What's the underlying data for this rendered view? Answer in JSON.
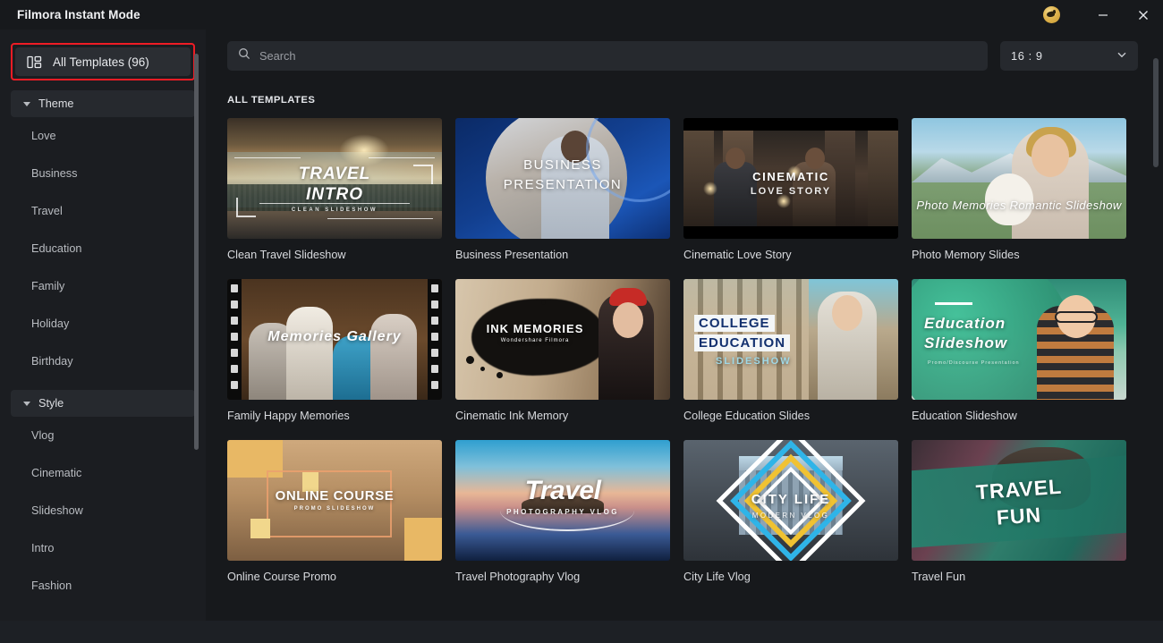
{
  "window": {
    "title": "Filmora Instant Mode",
    "brand_icon": "bird-badge-icon",
    "minimize_label": "Minimize",
    "close_label": "Close"
  },
  "sidebar": {
    "all_templates": {
      "icon": "layout-grid-icon",
      "label": "All Templates (96)",
      "count": 96,
      "highlight_color": "#ee1c25",
      "selected": true
    },
    "groups": [
      {
        "label": "Theme",
        "expanded": true,
        "items": [
          {
            "label": "Love"
          },
          {
            "label": "Business"
          },
          {
            "label": "Travel"
          },
          {
            "label": "Education"
          },
          {
            "label": "Family"
          },
          {
            "label": "Holiday"
          },
          {
            "label": "Birthday"
          }
        ]
      },
      {
        "label": "Style",
        "expanded": true,
        "items": [
          {
            "label": "Vlog"
          },
          {
            "label": "Cinematic"
          },
          {
            "label": "Slideshow"
          },
          {
            "label": "Intro"
          },
          {
            "label": "Fashion"
          }
        ]
      }
    ]
  },
  "toolbar": {
    "search": {
      "icon": "search-icon",
      "placeholder": "Search",
      "value": ""
    },
    "aspect_ratio": {
      "value": "16 : 9",
      "icon": "chevron-down-icon"
    }
  },
  "main": {
    "section_title": "ALL TEMPLATES",
    "templates": [
      {
        "name": "Clean Travel Slideshow",
        "thumb_text": [
          "TRAVEL",
          "INTRO",
          "CLEAN SLIDESHOW"
        ]
      },
      {
        "name": "Business Presentation",
        "thumb_text": [
          "BUSINESS",
          "PRESENTATION"
        ]
      },
      {
        "name": "Cinematic Love Story",
        "thumb_text": [
          "CINEMATIC",
          "LOVE STORY"
        ]
      },
      {
        "name": "Photo Memory Slides",
        "thumb_text": [
          "Photo Memories Romantic Slideshow"
        ]
      },
      {
        "name": "Family Happy Memories",
        "thumb_text": [
          "Memories Gallery"
        ]
      },
      {
        "name": "Cinematic Ink Memory",
        "thumb_text": [
          "INK MEMORIES",
          "Wondershare Filmora"
        ]
      },
      {
        "name": "College Education Slides",
        "thumb_text": [
          "COLLEGE",
          "EDUCATION",
          "SLIDESHOW"
        ]
      },
      {
        "name": "Education Slideshow",
        "thumb_text": [
          "Education",
          "Slideshow",
          "Promo/Discourse Presentation"
        ]
      },
      {
        "name": "Online Course Promo",
        "thumb_text": [
          "ONLINE COURSE",
          "PROMO SLIDESHOW"
        ]
      },
      {
        "name": "Travel Photography Vlog",
        "thumb_text": [
          "Travel",
          "PHOTOGRAPHY VLOG"
        ]
      },
      {
        "name": "City Life Vlog",
        "thumb_text": [
          "CITY LIFE",
          "MODERN VLOG"
        ]
      },
      {
        "name": "Travel Fun",
        "thumb_text": [
          "TRAVEL",
          "FUN"
        ]
      }
    ]
  },
  "colors": {
    "app_background": "#17191c",
    "sidebar_background": "#1b1d21",
    "control_background": "#26292e",
    "selected_item": "#2b2e33",
    "text_primary": "#e8eaed",
    "text_secondary": "#b9bcc1",
    "highlight": "#ee1c25"
  }
}
